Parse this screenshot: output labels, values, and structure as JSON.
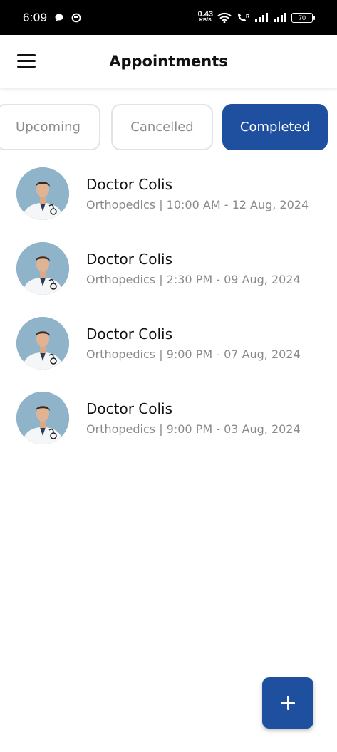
{
  "status_bar": {
    "time": "6:09",
    "net_speed_value": "0.43",
    "net_speed_unit": "KB/S",
    "battery": "70",
    "icons": [
      "chat-bubble-icon",
      "circle-notification-icon",
      "wifi-icon",
      "volte-call-icon",
      "signal-icon",
      "signal-icon",
      "battery-icon"
    ]
  },
  "header": {
    "title": "Appointments",
    "menu_icon": "hamburger-menu-icon"
  },
  "tabs": [
    {
      "label": "Upcoming",
      "active": false
    },
    {
      "label": "Cancelled",
      "active": false
    },
    {
      "label": "Completed",
      "active": true
    }
  ],
  "appointments": [
    {
      "name": "Doctor Colis",
      "details": "Orthopedics | 10:00 AM - 12 Aug, 2024"
    },
    {
      "name": "Doctor Colis",
      "details": "Orthopedics | 2:30 PM - 09 Aug, 2024"
    },
    {
      "name": "Doctor Colis",
      "details": "Orthopedics | 9:00 PM - 07 Aug, 2024"
    },
    {
      "name": "Doctor Colis",
      "details": "Orthopedics | 9:00 PM - 03 Aug, 2024"
    }
  ],
  "fab": {
    "icon": "plus-icon"
  },
  "colors": {
    "accent": "#1f4f9f",
    "text_primary": "#111111",
    "text_secondary": "#8a8a8a",
    "tab_border": "#e3e3e3"
  }
}
